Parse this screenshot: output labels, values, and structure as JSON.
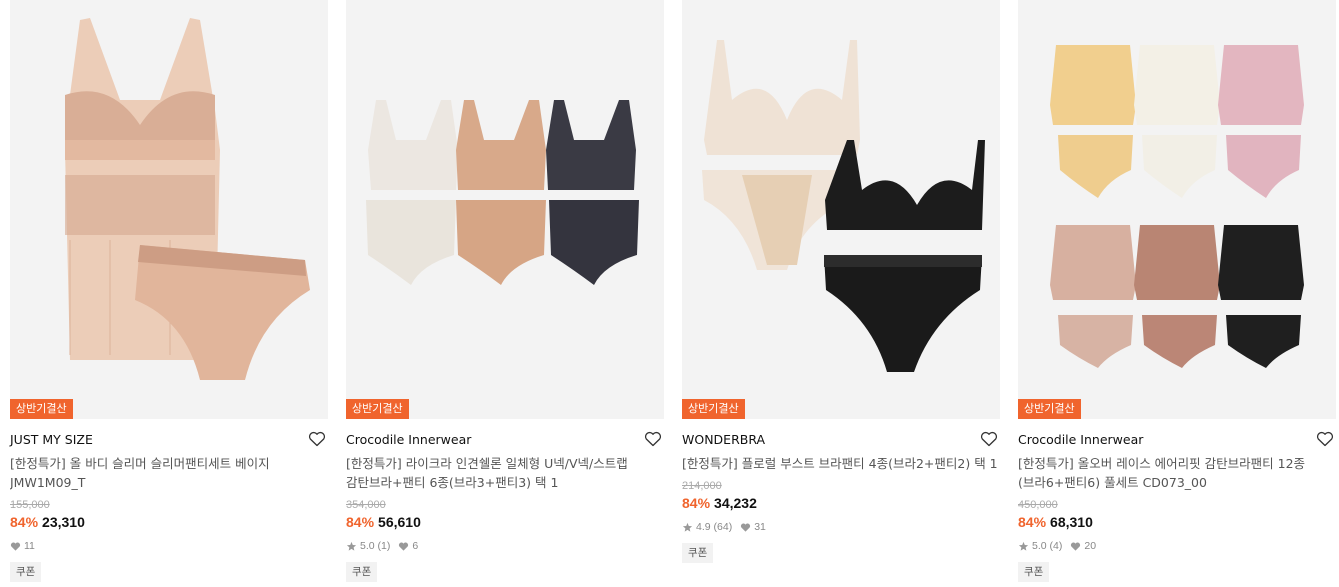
{
  "colors": {
    "accent": "#f0642d",
    "badge_bg": "#f0642d",
    "thumb_bg": "#f3f3f3"
  },
  "products": [
    {
      "badge": "상반기결산",
      "brand": "JUST MY SIZE",
      "title": "[한정특가] 올 바디 슬리머 슬리머팬티세트 베이지 JMW1M09_T",
      "original_price": "155,000",
      "discount": "84%",
      "price": "23,310",
      "rating": "",
      "reviews": "",
      "likes": "11",
      "coupon": "쿠폰",
      "image": "beige-slip-and-panty-set"
    },
    {
      "badge": "상반기결산",
      "brand": "Crocodile Innerwear",
      "title": "[한정특가] 라이크라 인견쉘론 일체형 U넥/V넥/스트랩 감탄브라+팬티 6종(브라3+팬티3) 택 1",
      "original_price": "354,000",
      "discount": "84%",
      "price": "56,610",
      "rating": "5.0",
      "reviews": "(1)",
      "likes": "6",
      "coupon": "쿠폰",
      "image": "seamless-bra-panty-6-set"
    },
    {
      "badge": "상반기결산",
      "brand": "WONDERBRA",
      "title": "[한정특가] 플로럴 부스트 브라팬티 4종(브라2+팬티2) 택 1",
      "original_price": "214,000",
      "discount": "84%",
      "price": "34,232",
      "rating": "4.9",
      "reviews": "(64)",
      "likes": "31",
      "coupon": "쿠폰",
      "image": "lace-bra-panty-4-set"
    },
    {
      "badge": "상반기결산",
      "brand": "Crocodile Innerwear",
      "title": "[한정특가] 올오버 레이스 에어리핏 감탄브라팬티 12종(브라6+팬티6) 풀세트 CD073_00",
      "original_price": "450,000",
      "discount": "84%",
      "price": "68,310",
      "rating": "5.0",
      "reviews": "(4)",
      "likes": "20",
      "coupon": "쿠폰",
      "image": "lace-bra-panty-12-set"
    }
  ]
}
